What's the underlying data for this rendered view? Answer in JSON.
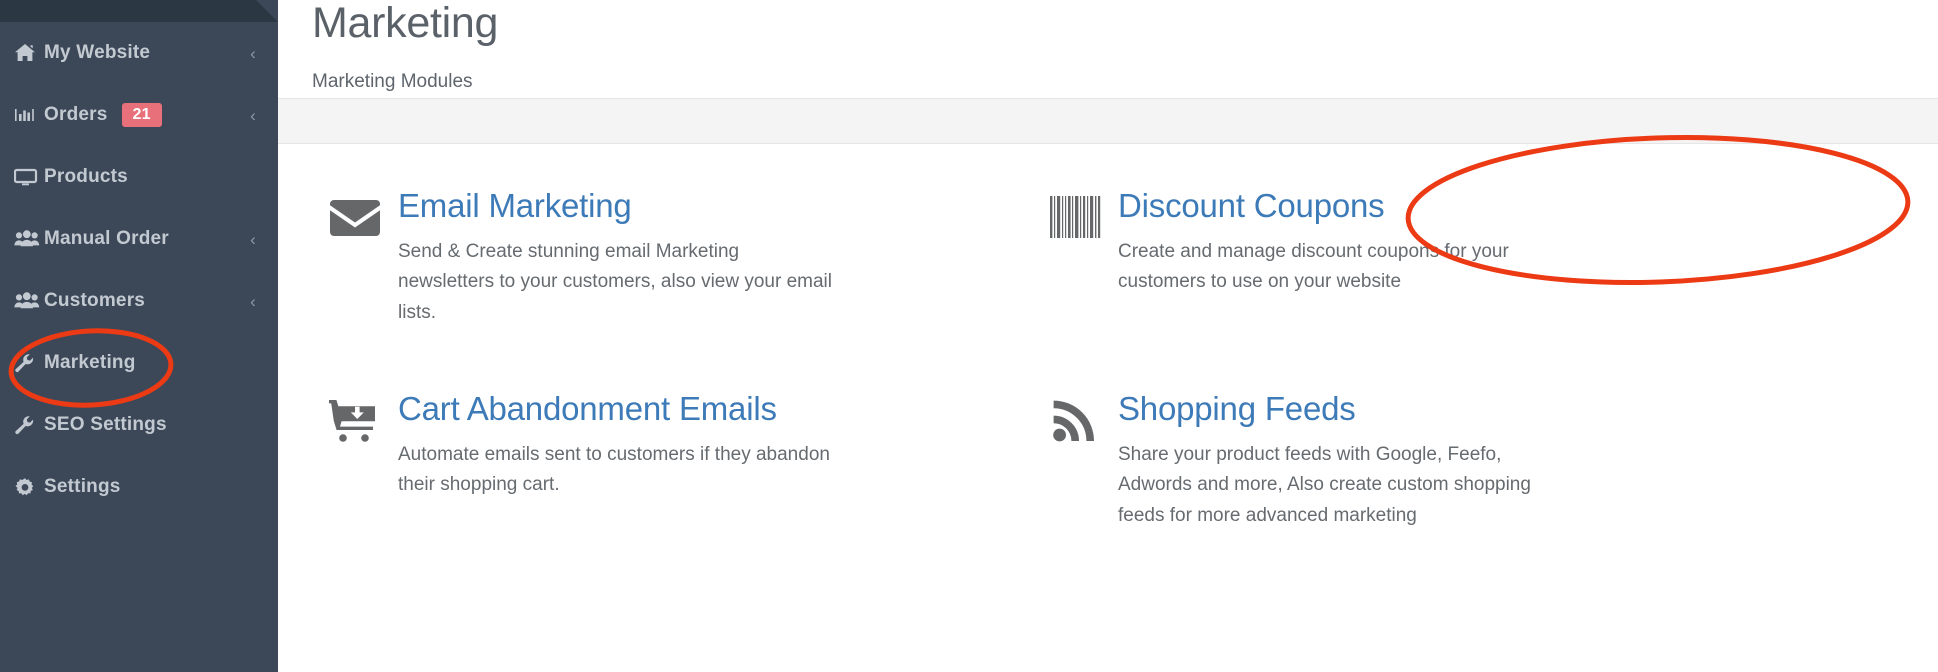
{
  "sidebar": {
    "items": [
      {
        "label": "My Website",
        "icon": "home-icon",
        "chevron": "‹",
        "badge": null
      },
      {
        "label": "Orders",
        "icon": "chart-bar-icon",
        "chevron": "‹",
        "badge": "21"
      },
      {
        "label": "Products",
        "icon": "monitor-icon",
        "chevron": null,
        "badge": null
      },
      {
        "label": "Manual Order",
        "icon": "users-icon",
        "chevron": "‹",
        "badge": null
      },
      {
        "label": "Customers",
        "icon": "users-icon",
        "chevron": "‹",
        "badge": null
      },
      {
        "label": "Marketing",
        "icon": "wrench-icon",
        "chevron": null,
        "badge": null
      },
      {
        "label": "SEO Settings",
        "icon": "wrench-icon",
        "chevron": null,
        "badge": null
      },
      {
        "label": "Settings",
        "icon": "gear-icon",
        "chevron": null,
        "badge": null
      }
    ]
  },
  "header": {
    "title": "Marketing",
    "subtitle": "Marketing Modules"
  },
  "modules": [
    {
      "title": "Email Marketing",
      "icon": "envelope-icon",
      "description": "Send & Create stunning email Marketing newsletters to your customers, also view your email lists."
    },
    {
      "title": "Discount Coupons",
      "icon": "barcode-icon",
      "description": "Create and manage discount coupons for your customers to use on your website"
    },
    {
      "title": "Cart Abandonment Emails",
      "icon": "cart-download-icon",
      "description": "Automate emails sent to customers if they abandon their shopping cart."
    },
    {
      "title": "Shopping Feeds",
      "icon": "rss-icon",
      "description": "Share your product feeds with Google, Feefo, Adwords and more, Also create custom shopping feeds for more advanced marketing"
    }
  ],
  "annotations": {
    "marketing_highlight": "Marketing",
    "coupons_highlight": "Discount Coupons"
  },
  "colors": {
    "sidebar_bg": "#3c4858",
    "sidebar_topbar": "#2c3744",
    "badge": "#e8707a",
    "link": "#3d7ab8",
    "annotation": "#ec3a15"
  }
}
